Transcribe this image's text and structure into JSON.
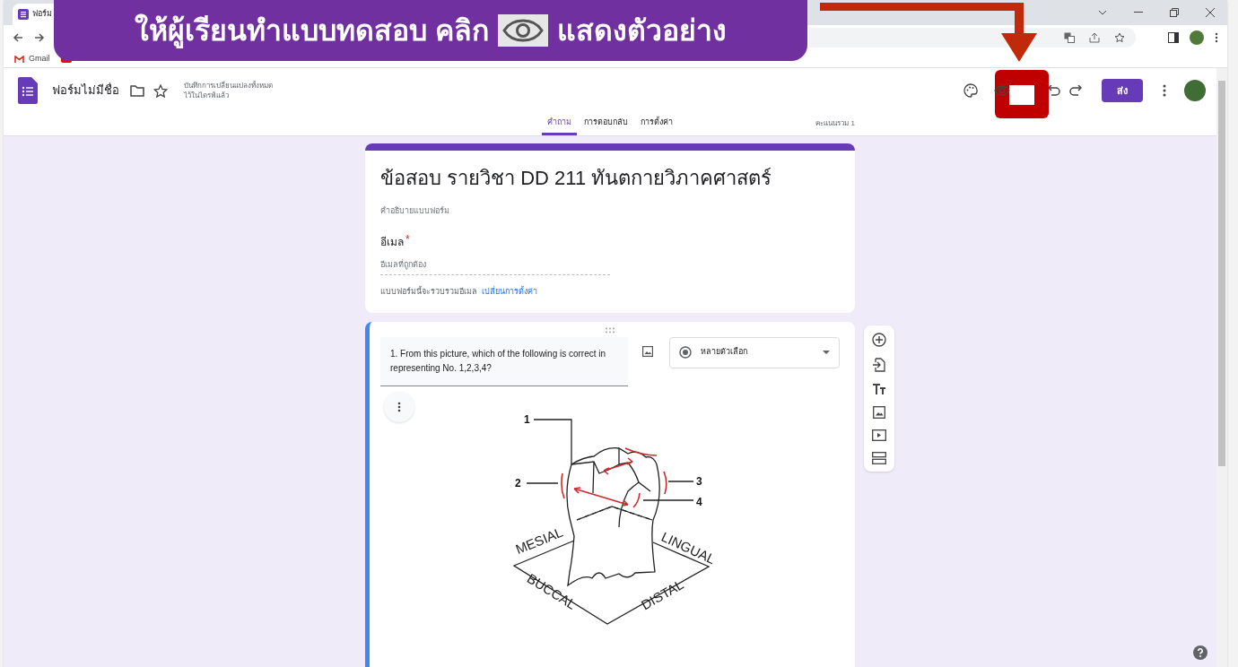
{
  "annotation": {
    "text_before": "ให้ผู้เรียนทำแบบทดสอบ คลิก",
    "text_after": "แสดงตัวอย่าง"
  },
  "browser": {
    "tab_title": "ฟอร์ม",
    "bookmarks": [
      {
        "label": "Gmail"
      }
    ]
  },
  "app_bar": {
    "title": "ฟอร์มไม่มีชื่อ",
    "save_status": [
      "บันทึกการเปลี่ยนแปลงทั้งหมด",
      "ไว้ในไดรฟ์แล้ว"
    ],
    "send_button": "ส่ง"
  },
  "tabs": [
    {
      "label": "คำถาม",
      "selected": true
    },
    {
      "label": "การตอบกลับ",
      "selected": false
    },
    {
      "label": "การตั้งค่า",
      "selected": false
    }
  ],
  "total_points": "คะแนนรวม 1",
  "form_header": {
    "title": "ข้อสอบ รายวิชา DD 211 ทันตกายวิภาคศาสตร์",
    "description_placeholder": "คำอธิบายแบบฟอร์ม",
    "email_label": "อีเมล",
    "required_mark": "*",
    "email_placeholder": "อีเมลที่ถูกต้อง",
    "collect_note": "แบบฟอร์มนี้จะรวบรวมอีเมล",
    "settings_link": "เปลี่ยนการตั้งค่า"
  },
  "question": {
    "text": "1. From this picture, which of the following is correct in representing No. 1,2,3,4?",
    "type_label": "หลายตัวเลือก",
    "image_labels": {
      "numbers": [
        "1",
        "2",
        "3",
        "4"
      ],
      "surfaces": [
        "MESIAL",
        "LINGUAL",
        "BUCCAL",
        "DISTAL"
      ]
    }
  }
}
